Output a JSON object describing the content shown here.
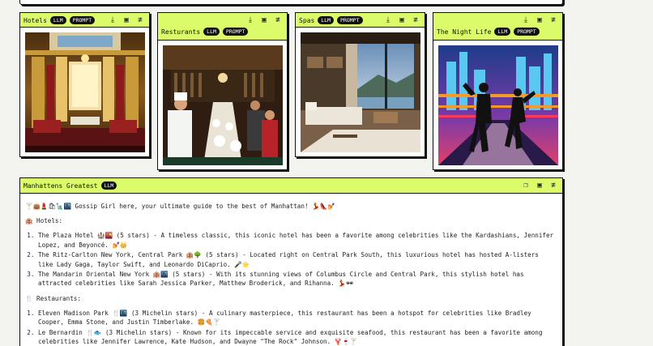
{
  "cards": [
    {
      "id": "hotels",
      "title": "Hotels",
      "badges": [
        "LLM",
        "PROMPT"
      ]
    },
    {
      "id": "restaurants",
      "title": "Resturants",
      "badges": [
        "LLM",
        "PROMPT"
      ]
    },
    {
      "id": "spas",
      "title": "Spas",
      "badges": [
        "LLM",
        "PROMPT"
      ]
    },
    {
      "id": "nightlife",
      "title": "The Night Life",
      "badges": [
        "LLM",
        "PROMPT"
      ]
    }
  ],
  "card_icons": [
    "download-icon",
    "save-icon",
    "settings-icon"
  ],
  "panel": {
    "title": "Manhattens Greatest",
    "badge": "LLM",
    "icons": [
      "copy-icon",
      "save-icon",
      "settings-icon"
    ],
    "intro_emoji": "🍸👜💄🛍🗽🌃",
    "intro": "Gossip Girl here, your ultimate guide to the best of Manhattan!",
    "intro_end": "💃👠💅",
    "hotels_heading_emoji": "🏨",
    "hotels_heading": "Hotels:",
    "hotels": [
      {
        "name": "The Plaza Hotel",
        "emoji": "🏰🌇",
        "text": "(5 stars) - A timeless classic, this iconic hotel has been a favorite among celebrities like the Kardashians, Jennifer Lopez, and Beyoncé.",
        "end": "💅👑"
      },
      {
        "name": "The Ritz-Carlton New York, Central Park",
        "emoji": "🏨🌳",
        "text": "(5 stars) - Located right on Central Park South, this luxurious hotel has hosted A-listers like Lady Gaga, Taylor Swift, and Leonardo DiCaprio.",
        "end": "🎤🌟"
      },
      {
        "name": "The Mandarin Oriental New York",
        "emoji": "🏨🌃",
        "text": "(5 stars) - With its stunning views of Columbus Circle and Central Park, this stylish hotel has attracted celebrities like Sarah Jessica Parker, Matthew Broderick, and Rihanna.",
        "end": "💃🕶"
      }
    ],
    "restaurants_heading_emoji": "🍴",
    "restaurants_heading": "Restaurants:",
    "restaurants": [
      {
        "name": "Eleven Madison Park",
        "emoji": "🍴🌃",
        "text": "(3 Michelin stars) - A culinary masterpiece, this restaurant has been a hotspot for celebrities like Bradley Cooper, Emma Stone, and Justin Timberlake.",
        "end": "🍔🍕🍸"
      },
      {
        "name": "Le Bernardin",
        "emoji": "🍴🐟",
        "text": "(3 Michelin stars) - Known for its impeccable service and exquisite seafood, this restaurant has been a favorite among celebrities like Jennifer Lawrence, Kate Hudson, and Dwayne \"The Rock\" Johnson.",
        "end": "🦞🍷🍸"
      }
    ]
  }
}
